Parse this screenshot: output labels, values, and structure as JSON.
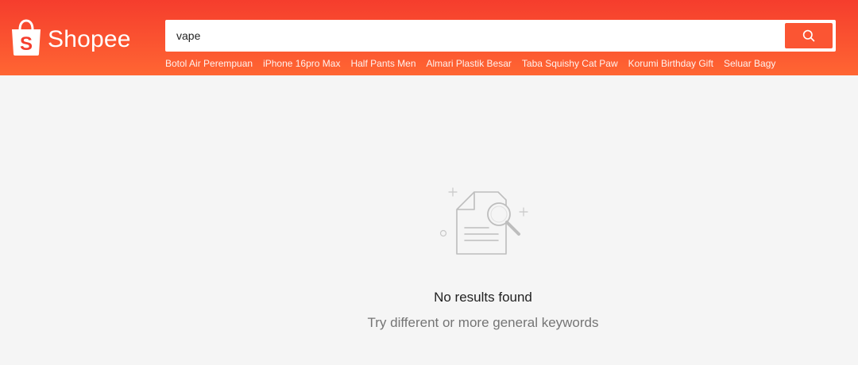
{
  "header": {
    "brand": "Shopee",
    "search": {
      "value": "vape",
      "button_icon": "search-icon"
    },
    "suggestions": [
      "Botol Air Perempuan",
      "iPhone 16pro Max",
      "Half Pants Men",
      "Almari Plastik Besar",
      "Taba Squishy Cat Paw",
      "Korumi Birthday Gift",
      "Seluar Bagy"
    ]
  },
  "empty_state": {
    "icon": "no-results-illustration",
    "title": "No results found",
    "subtitle": "Try different or more general keywords"
  },
  "colors": {
    "brand": "#ee4d2d",
    "header_gradient_start": "#f53d2d",
    "header_gradient_end": "#ff6633",
    "background": "#f5f5f5"
  }
}
